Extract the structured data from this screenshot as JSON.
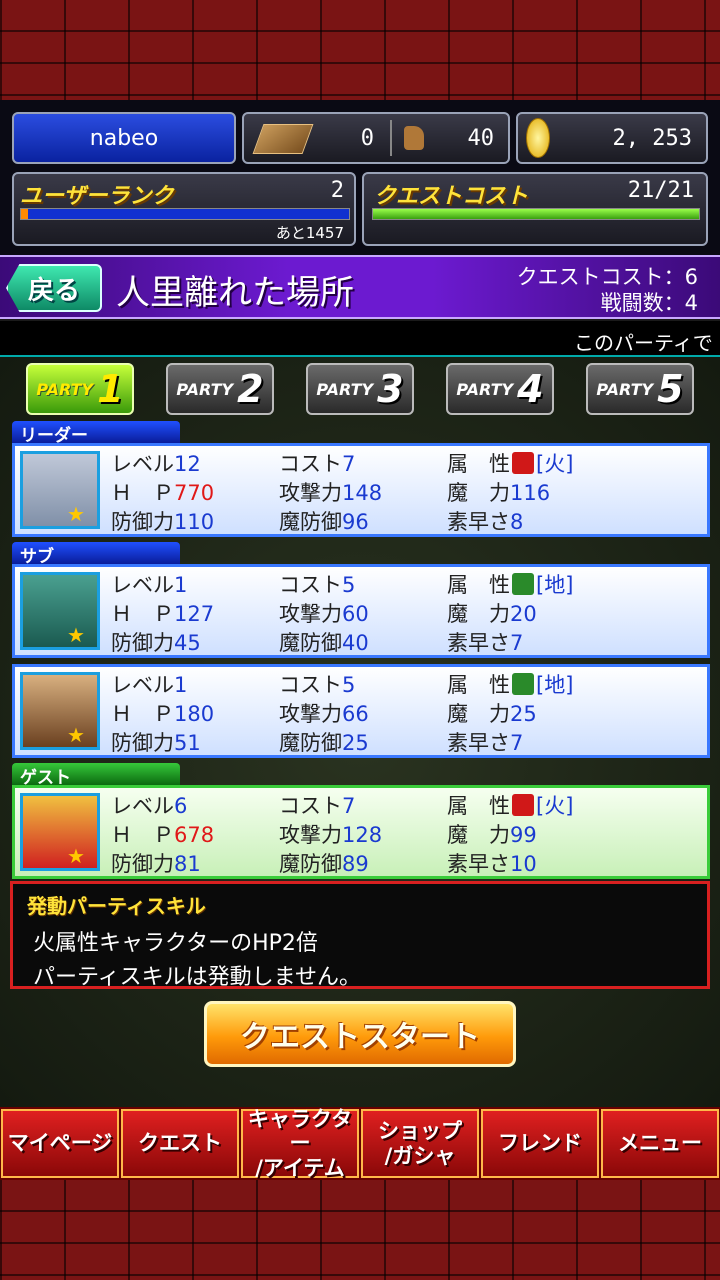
{
  "header": {
    "username": "nabeo",
    "materials": "0",
    "items": "40",
    "gold": "2, 253",
    "rank_label": "ユーザーランク",
    "rank_value": "2",
    "rank_remaining": "あと1457",
    "rank_progress": 0.02,
    "cost_label": "クエストコスト",
    "cost_value": "21/21",
    "cost_progress": 1.0
  },
  "title": {
    "back_label": "戻る",
    "quest_name": "人里離れた場所",
    "quest_cost": "クエストコスト：6",
    "battle_count": "戦闘数：4"
  },
  "ticker": "このパーティで",
  "party_tabs": [
    {
      "word": "PARTY",
      "num": "1",
      "active": true
    },
    {
      "word": "PARTY",
      "num": "2",
      "active": false
    },
    {
      "word": "PARTY",
      "num": "3",
      "active": false
    },
    {
      "word": "PARTY",
      "num": "4",
      "active": false
    },
    {
      "word": "PARTY",
      "num": "5",
      "active": false
    }
  ],
  "labels": {
    "level": "レベル",
    "hp": "Ｈ　Ｐ",
    "def": "防御力",
    "cost": "コスト",
    "atk": "攻撃力",
    "mdef": "魔防御",
    "attr": "属　性",
    "mag": "魔　力",
    "spd": "素早さ"
  },
  "sections": {
    "leader": "リーダー",
    "sub": "サブ",
    "guest": "ゲスト"
  },
  "members": [
    {
      "level": "12",
      "hp": "770",
      "hp_red": true,
      "def": "110",
      "cost": "7",
      "atk": "148",
      "mdef": "96",
      "attr": "[火]",
      "attr_icon": "fire-icon",
      "mag": "116",
      "spd": "8"
    },
    {
      "level": "1",
      "hp": "127",
      "hp_red": false,
      "def": "45",
      "cost": "5",
      "atk": "60",
      "mdef": "40",
      "attr": "[地]",
      "attr_icon": "earth-icon",
      "mag": "20",
      "spd": "7"
    },
    {
      "level": "1",
      "hp": "180",
      "hp_red": false,
      "def": "51",
      "cost": "5",
      "atk": "66",
      "mdef": "25",
      "attr": "[地]",
      "attr_icon": "earth-icon",
      "mag": "25",
      "spd": "7"
    },
    {
      "level": "6",
      "hp": "678",
      "hp_red": true,
      "def": "81",
      "cost": "7",
      "atk": "128",
      "mdef": "89",
      "attr": "[火]",
      "attr_icon": "fire-icon",
      "mag": "99",
      "spd": "10"
    }
  ],
  "skill": {
    "title": "発動パーティスキル",
    "line1": "火属性キャラクターのHP2倍",
    "line2": "パーティスキルは発動しません。"
  },
  "start_button": "クエストスタート",
  "nav": [
    {
      "l1": "マイページ",
      "l2": ""
    },
    {
      "l1": "クエスト",
      "l2": ""
    },
    {
      "l1": "キャラクター",
      "l2": "/アイテム"
    },
    {
      "l1": "ショップ",
      "l2": "/ガシャ"
    },
    {
      "l1": "フレンド",
      "l2": ""
    },
    {
      "l1": "メニュー",
      "l2": ""
    }
  ],
  "colors": {
    "fire": "#d01818",
    "earth": "#2a8a2a"
  }
}
